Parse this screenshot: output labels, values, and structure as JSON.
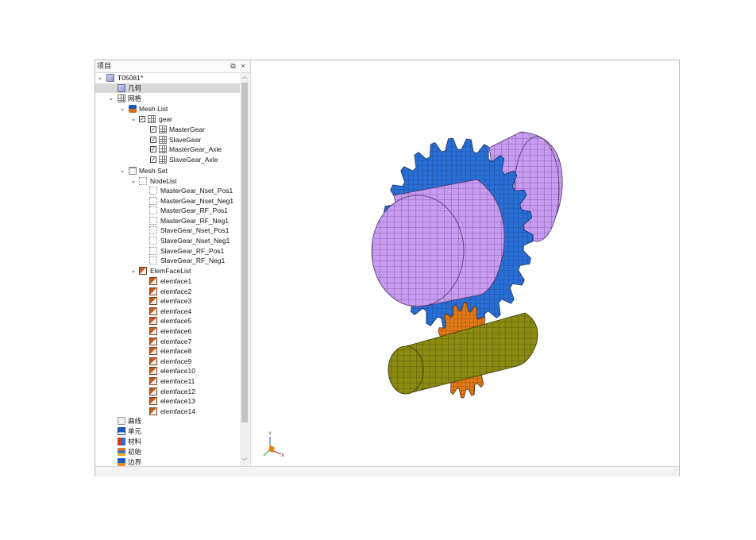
{
  "panel": {
    "title": "项目",
    "pin_icon": "pin-icon",
    "close_symbol": "×"
  },
  "tree": {
    "project": "T05081*",
    "geometry": "几何",
    "mesh": "网格",
    "mesh_list": "Mesh List",
    "gear": "gear",
    "mesh_items": [
      "MasterGear",
      "SlaveGear",
      "MasterGear_Axle",
      "SlaveGear_Axle"
    ],
    "mesh_set": "Mesh Set",
    "node_list": "NodeList",
    "node_items": [
      "MasterGear_Nset_Pos1",
      "MasterGear_Nset_Neg1",
      "MasterGear_RF_Pos1",
      "MasterGear_RF_Neg1",
      "SlaveGear_Nset_Pos1",
      "SlaveGear_Nset_Neg1",
      "SlaveGear_RF_Pos1",
      "SlaveGear_RF_Neg1"
    ],
    "elem_face_list": "ElemFaceList",
    "elem_items": [
      "elemface1",
      "elemface2",
      "elemface3",
      "elemface4",
      "elemface5",
      "elemface6",
      "elemface7",
      "elemface8",
      "elemface9",
      "elemface10",
      "elemface11",
      "elemface12",
      "elemface13",
      "elemface14"
    ],
    "curves": "曲线",
    "units": "单元",
    "materials": "材料",
    "initial": "初始",
    "boundary": "边界"
  },
  "viewport": {
    "axis_y": "Y",
    "axis_x": "X",
    "colors": {
      "master_gear": "#2a6fd6",
      "master_axle": "#c79bf0",
      "slave_gear": "#e07a1a",
      "slave_axle": "#8a8a10"
    }
  }
}
